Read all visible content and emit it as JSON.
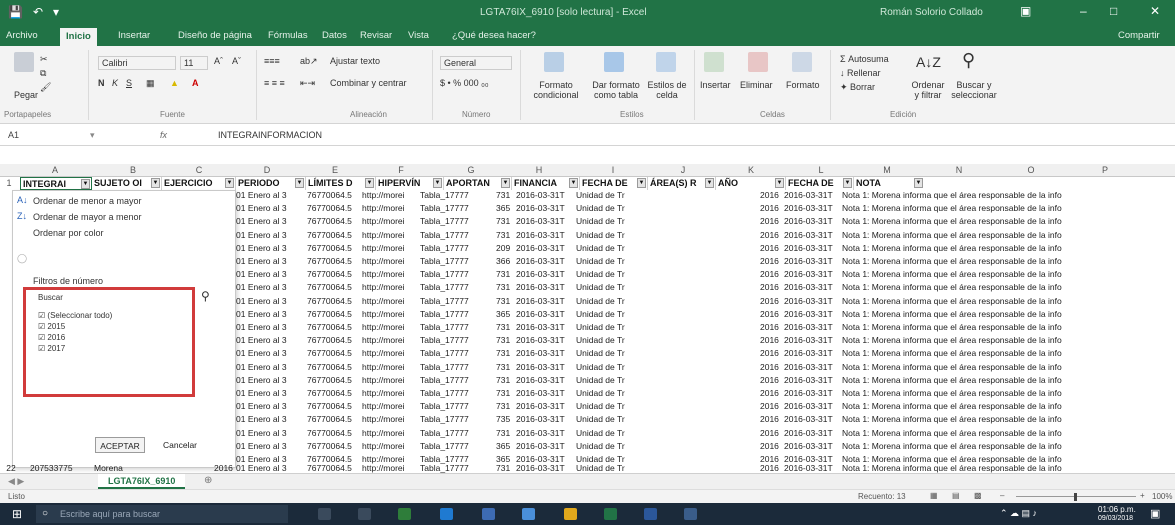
{
  "window": {
    "title": "LGTA76IX_6910 [solo lectura] - Excel",
    "user": "Román Solorio Collado"
  },
  "tabs": [
    {
      "label": "Archivo"
    },
    {
      "label": "Inicio"
    },
    {
      "label": "Insertar"
    },
    {
      "label": "Diseño de página"
    },
    {
      "label": "Fórmulas"
    },
    {
      "label": "Datos"
    },
    {
      "label": "Revisar"
    },
    {
      "label": "Vista"
    },
    {
      "label": "¿Qué desea hacer?"
    }
  ],
  "share_label": "Compartir",
  "ribbon": {
    "paste": "Pegar",
    "font_name": "Calibri",
    "font_size": "11",
    "bold": "N",
    "italic": "K",
    "underline": "S",
    "wrap_text": "Ajustar texto",
    "merge_center": "Combinar y centrar",
    "number_format": "General",
    "conditional_format": "Formato condicional",
    "format_as_table": "Dar formato como tabla",
    "cell_styles": "Estilos de celda",
    "insert": "Insertar",
    "delete": "Eliminar",
    "format": "Formato",
    "autosum": "Autosuma",
    "fill": "Rellenar",
    "clear": "Borrar",
    "sort_filter": "Ordenar y filtrar",
    "find_select": "Buscar y seleccionar",
    "groups": [
      "Portapapeles",
      "Fuente",
      "Alineación",
      "Número",
      "Estilos",
      "Celdas",
      "Edición"
    ]
  },
  "formula_bar": {
    "cell_ref": "A1",
    "fx": "fx",
    "content": "INTEGRAINFORMACION"
  },
  "columns": [
    "A",
    "B",
    "C",
    "D",
    "E",
    "F",
    "G",
    "H",
    "I",
    "J",
    "K",
    "L",
    "M",
    "N",
    "O",
    "P"
  ],
  "header_row": {
    "row_num": "1",
    "cells": [
      "INTEGRAI",
      "SUJETO OI",
      "EJERCICIO",
      "PERIODO",
      "LÍMITES D",
      "HIPERVÍN",
      "APORTAN",
      "FINANCIA",
      "FECHA DE",
      "ÁREA(S) R",
      "AÑO",
      "FECHA DE",
      "NOTA"
    ]
  },
  "filter_menu": {
    "sort_asc": "Ordenar de menor a mayor",
    "sort_desc": "Ordenar de mayor a menor",
    "sort_color": "Ordenar por color",
    "number_filters": "Filtros de número",
    "search": "Buscar",
    "select_all": "(Seleccionar todo)",
    "options": [
      "2015",
      "2016",
      "2017"
    ],
    "accept": "ACEPTAR",
    "cancel": "Cancelar"
  },
  "data_rows": [
    {
      "periodo": "01 Enero al 3",
      "limites": "76770064.5",
      "hipervin": "http://morei",
      "aportan": "Tabla_17777",
      "financia": "731",
      "fecha": "2016-03-31T",
      "area": "Unidad de Tr",
      "anio": "2016",
      "fecha2": "2016-03-31T",
      "nota": "Nota 1: Morena informa que el área responsable de la info"
    },
    {
      "periodo": "01 Enero al 3",
      "limites": "76770064.5",
      "hipervin": "http://morei",
      "aportan": "Tabla_17777",
      "financia": "365",
      "fecha": "2016-03-31T",
      "area": "Unidad de Tr",
      "anio": "2016",
      "fecha2": "2016-03-31T",
      "nota": "Nota 1: Morena informa que el área responsable de la info"
    },
    {
      "periodo": "01 Enero al 3",
      "limites": "76770064.5",
      "hipervin": "http://morei",
      "aportan": "Tabla_17777",
      "financia": "731",
      "fecha": "2016-03-31T",
      "area": "Unidad de Tr",
      "anio": "2016",
      "fecha2": "2016-03-31T",
      "nota": "Nota 1: Morena informa que el área responsable de la info"
    },
    {
      "periodo": "01 Enero al 3",
      "limites": "76770064.5",
      "hipervin": "http://morei",
      "aportan": "Tabla_17777",
      "financia": "731",
      "fecha": "2016-03-31T",
      "area": "Unidad de Tr",
      "anio": "2016",
      "fecha2": "2016-03-31T",
      "nota": "Nota 1: Morena informa que el área responsable de la info"
    },
    {
      "periodo": "01 Enero al 3",
      "limites": "76770064.5",
      "hipervin": "http://morei",
      "aportan": "Tabla_17777",
      "financia": "209",
      "fecha": "2016-03-31T",
      "area": "Unidad de Tr",
      "anio": "2016",
      "fecha2": "2016-03-31T",
      "nota": "Nota 1: Morena informa que el área responsable de la info"
    },
    {
      "periodo": "01 Enero al 3",
      "limites": "76770064.5",
      "hipervin": "http://morei",
      "aportan": "Tabla_17777",
      "financia": "366",
      "fecha": "2016-03-31T",
      "area": "Unidad de Tr",
      "anio": "2016",
      "fecha2": "2016-03-31T",
      "nota": "Nota 1: Morena informa que el área responsable de la info"
    },
    {
      "periodo": "01 Enero al 3",
      "limites": "76770064.5",
      "hipervin": "http://morei",
      "aportan": "Tabla_17777",
      "financia": "731",
      "fecha": "2016-03-31T",
      "area": "Unidad de Tr",
      "anio": "2016",
      "fecha2": "2016-03-31T",
      "nota": "Nota 1: Morena informa que el área responsable de la info"
    },
    {
      "periodo": "01 Enero al 3",
      "limites": "76770064.5",
      "hipervin": "http://morei",
      "aportan": "Tabla_17777",
      "financia": "731",
      "fecha": "2016-03-31T",
      "area": "Unidad de Tr",
      "anio": "2016",
      "fecha2": "2016-03-31T",
      "nota": "Nota 1: Morena informa que el área responsable de la info"
    },
    {
      "periodo": "01 Enero al 3",
      "limites": "76770064.5",
      "hipervin": "http://morei",
      "aportan": "Tabla_17777",
      "financia": "731",
      "fecha": "2016-03-31T",
      "area": "Unidad de Tr",
      "anio": "2016",
      "fecha2": "2016-03-31T",
      "nota": "Nota 1: Morena informa que el área responsable de la info"
    },
    {
      "periodo": "01 Enero al 3",
      "limites": "76770064.5",
      "hipervin": "http://morei",
      "aportan": "Tabla_17777",
      "financia": "365",
      "fecha": "2016-03-31T",
      "area": "Unidad de Tr",
      "anio": "2016",
      "fecha2": "2016-03-31T",
      "nota": "Nota 1: Morena informa que el área responsable de la info"
    },
    {
      "periodo": "01 Enero al 3",
      "limites": "76770064.5",
      "hipervin": "http://morei",
      "aportan": "Tabla_17777",
      "financia": "731",
      "fecha": "2016-03-31T",
      "area": "Unidad de Tr",
      "anio": "2016",
      "fecha2": "2016-03-31T",
      "nota": "Nota 1: Morena informa que el área responsable de la info"
    },
    {
      "periodo": "01 Enero al 3",
      "limites": "76770064.5",
      "hipervin": "http://morei",
      "aportan": "Tabla_17777",
      "financia": "731",
      "fecha": "2016-03-31T",
      "area": "Unidad de Tr",
      "anio": "2016",
      "fecha2": "2016-03-31T",
      "nota": "Nota 1: Morena informa que el área responsable de la info"
    },
    {
      "periodo": "01 Enero al 3",
      "limites": "76770064.5",
      "hipervin": "http://morei",
      "aportan": "Tabla_17777",
      "financia": "731",
      "fecha": "2016-03-31T",
      "area": "Unidad de Tr",
      "anio": "2016",
      "fecha2": "2016-03-31T",
      "nota": "Nota 1: Morena informa que el área responsable de la info"
    },
    {
      "periodo": "01 Enero al 3",
      "limites": "76770064.5",
      "hipervin": "http://morei",
      "aportan": "Tabla_17777",
      "financia": "731",
      "fecha": "2016-03-31T",
      "area": "Unidad de Tr",
      "anio": "2016",
      "fecha2": "2016-03-31T",
      "nota": "Nota 1: Morena informa que el área responsable de la info"
    },
    {
      "periodo": "01 Enero al 3",
      "limites": "76770064.5",
      "hipervin": "http://morei",
      "aportan": "Tabla_17777",
      "financia": "731",
      "fecha": "2016-03-31T",
      "area": "Unidad de Tr",
      "anio": "2016",
      "fecha2": "2016-03-31T",
      "nota": "Nota 1: Morena informa que el área responsable de la info"
    },
    {
      "periodo": "01 Enero al 3",
      "limites": "76770064.5",
      "hipervin": "http://morei",
      "aportan": "Tabla_17777",
      "financia": "731",
      "fecha": "2016-03-31T",
      "area": "Unidad de Tr",
      "anio": "2016",
      "fecha2": "2016-03-31T",
      "nota": "Nota 1: Morena informa que el área responsable de la info"
    },
    {
      "periodo": "01 Enero al 3",
      "limites": "76770064.5",
      "hipervin": "http://morei",
      "aportan": "Tabla_17777",
      "financia": "731",
      "fecha": "2016-03-31T",
      "area": "Unidad de Tr",
      "anio": "2016",
      "fecha2": "2016-03-31T",
      "nota": "Nota 1: Morena informa que el área responsable de la info"
    },
    {
      "periodo": "01 Enero al 3",
      "limites": "76770064.5",
      "hipervin": "http://morei",
      "aportan": "Tabla_17777",
      "financia": "735",
      "fecha": "2016-03-31T",
      "area": "Unidad de Tr",
      "anio": "2016",
      "fecha2": "2016-03-31T",
      "nota": "Nota 1: Morena informa que el área responsable de la info"
    },
    {
      "periodo": "01 Enero al 3",
      "limites": "76770064.5",
      "hipervin": "http://morei",
      "aportan": "Tabla_17777",
      "financia": "731",
      "fecha": "2016-03-31T",
      "area": "Unidad de Tr",
      "anio": "2016",
      "fecha2": "2016-03-31T",
      "nota": "Nota 1: Morena informa que el área responsable de la info"
    },
    {
      "periodo": "01 Enero al 3",
      "limites": "76770064.5",
      "hipervin": "http://morei",
      "aportan": "Tabla_17777",
      "financia": "365",
      "fecha": "2016-03-31T",
      "area": "Unidad de Tr",
      "anio": "2016",
      "fecha2": "2016-03-31T",
      "nota": "Nota 1: Morena informa que el área responsable de la info"
    },
    {
      "periodo": "01 Enero al 3",
      "limites": "76770064.5",
      "hipervin": "http://morei",
      "aportan": "Tabla_17777",
      "financia": "365",
      "fecha": "2016-03-31T",
      "area": "Unidad de Tr",
      "anio": "2016",
      "fecha2": "2016-03-31T",
      "nota": "Nota 1: Morena informa que el área responsable de la info"
    }
  ],
  "last_row": {
    "row_num": "22",
    "integra": "207533775",
    "sujeto": "Morena",
    "ejercicio": "2016",
    "periodo": "01 Enero al 3",
    "limites": "76770064.5",
    "hipervin": "http://morei",
    "aportan": "Tabla_17777",
    "financia": "731",
    "fecha": "2016-03-31T",
    "area": "Unidad de Tr",
    "anio": "2016",
    "fecha2": "2016-03-31T",
    "nota": "Nota 1: Morena informa que el área responsable de la info"
  },
  "sheet_tab": "LGTA76IX_6910",
  "status": {
    "mode": "Listo",
    "count": "Recuento: 13",
    "zoom": "100%"
  },
  "taskbar": {
    "search_placeholder": "Escribe aquí para buscar",
    "time": "01:06 p.m.",
    "date": "09/03/2018"
  }
}
